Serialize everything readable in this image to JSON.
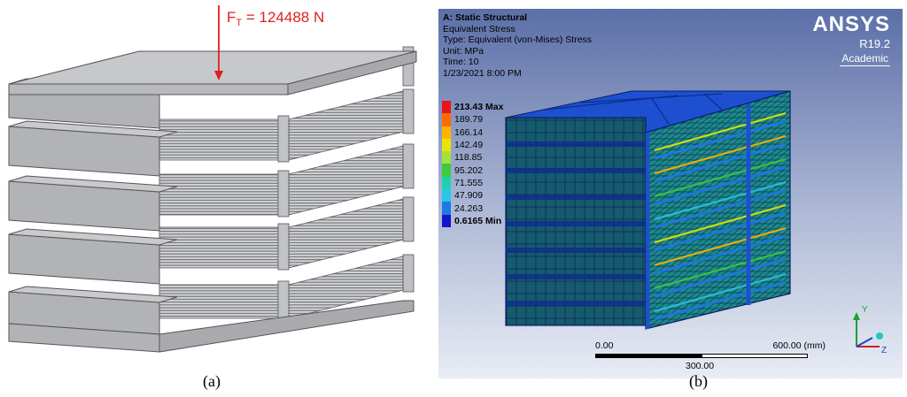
{
  "panel_a": {
    "force_label_main": "F",
    "force_label_sub": "T",
    "force_label_value": " = 124488 N",
    "caption": "(a)",
    "colors": {
      "force": "#e02020",
      "top_plate": "#c7c8cc",
      "slab_front": "#b2b3b7"
    }
  },
  "panel_b": {
    "header": {
      "title": "A: Static Structural",
      "line1": "Equivalent Stress",
      "line2": "Type: Equivalent (von-Mises) Stress",
      "line3": "Unit: MPa",
      "line4": "Time: 10",
      "line5": "1/23/2021 8:00 PM"
    },
    "brand": {
      "logo": "ANSYS",
      "version": "R19.2",
      "edition": "Academic"
    },
    "legend": [
      {
        "label": "213.43 Max",
        "color": "#e8141c",
        "bold": true
      },
      {
        "label": "189.79",
        "color": "#ff6a00",
        "bold": false
      },
      {
        "label": "166.14",
        "color": "#ffb400",
        "bold": false
      },
      {
        "label": "142.49",
        "color": "#e6e600",
        "bold": false
      },
      {
        "label": "118.85",
        "color": "#a6e23c",
        "bold": false
      },
      {
        "label": "95.202",
        "color": "#3ccc3c",
        "bold": false
      },
      {
        "label": "71.555",
        "color": "#20d2a8",
        "bold": false
      },
      {
        "label": "47.909",
        "color": "#28c8e6",
        "bold": false
      },
      {
        "label": "24.263",
        "color": "#1e78e6",
        "bold": false
      },
      {
        "label": "0.6165 Min",
        "color": "#1414c8",
        "bold": true
      }
    ],
    "scale_bar": {
      "left": "0.00",
      "right": "600.00 (mm)",
      "middle": "300.00"
    },
    "triad": {
      "y": "Y",
      "z": "Z"
    },
    "caption": "(b)"
  }
}
